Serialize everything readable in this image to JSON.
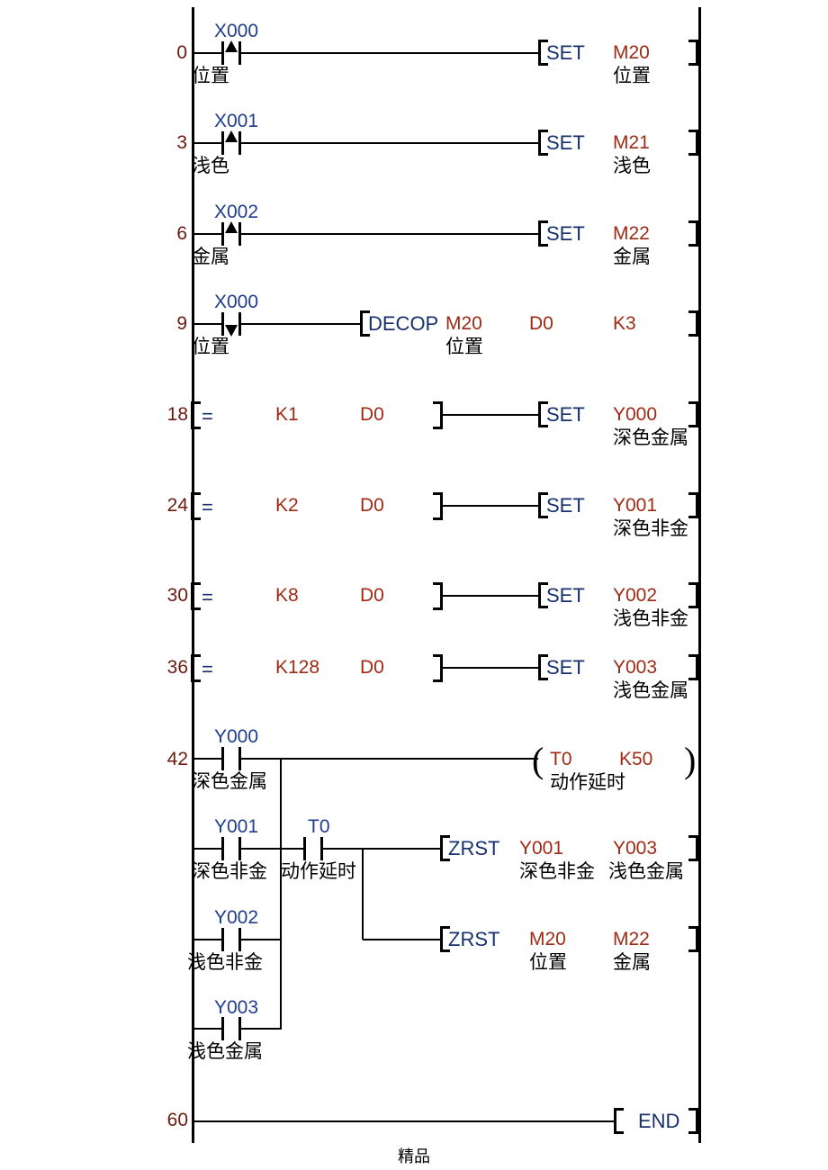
{
  "document": {
    "footer": "精品"
  },
  "colors": {
    "device_blue": "#1f3d8c",
    "device_red": "#9e2a14",
    "instruction": "#16306e",
    "comment": "#000000",
    "step_number": "#6a1b0e",
    "wire": "#000000"
  },
  "program": {
    "rungs": [
      {
        "step": "0",
        "contact": {
          "device": "X000",
          "comment": "位置",
          "type": "rising-edge"
        },
        "instruction": "SET",
        "operands": [
          {
            "device": "M20",
            "comment": "位置"
          }
        ]
      },
      {
        "step": "3",
        "contact": {
          "device": "X001",
          "comment": "浅色",
          "type": "rising-edge"
        },
        "instruction": "SET",
        "operands": [
          {
            "device": "M21",
            "comment": "浅色"
          }
        ]
      },
      {
        "step": "6",
        "contact": {
          "device": "X002",
          "comment": "金属",
          "type": "rising-edge"
        },
        "instruction": "SET",
        "operands": [
          {
            "device": "M22",
            "comment": "金属"
          }
        ]
      },
      {
        "step": "9",
        "contact": {
          "device": "X000",
          "comment": "位置",
          "type": "falling-edge"
        },
        "instruction": "DECOP",
        "operands": [
          {
            "device": "M20",
            "comment": "位置"
          },
          {
            "device": "D0",
            "comment": ""
          },
          {
            "device": "K3",
            "comment": ""
          }
        ]
      },
      {
        "step": "18",
        "compare": {
          "operator": "=",
          "left": "K1",
          "right": "D0"
        },
        "instruction": "SET",
        "operands": [
          {
            "device": "Y000",
            "comment": "深色金属"
          }
        ]
      },
      {
        "step": "24",
        "compare": {
          "operator": "=",
          "left": "K2",
          "right": "D0"
        },
        "instruction": "SET",
        "operands": [
          {
            "device": "Y001",
            "comment": "深色非金"
          }
        ]
      },
      {
        "step": "30",
        "compare": {
          "operator": "=",
          "left": "K8",
          "right": "D0"
        },
        "instruction": "SET",
        "operands": [
          {
            "device": "Y002",
            "comment": "浅色非金"
          }
        ]
      },
      {
        "step": "36",
        "compare": {
          "operator": "=",
          "left": "K128",
          "right": "D0"
        },
        "instruction": "SET",
        "operands": [
          {
            "device": "Y003",
            "comment": "浅色金属"
          }
        ]
      },
      {
        "step": "42",
        "branch_contacts": [
          {
            "device": "Y000",
            "comment": "深色金属",
            "type": "normally-open"
          },
          {
            "device": "Y001",
            "comment": "深色非金",
            "type": "normally-open"
          },
          {
            "device": "Y002",
            "comment": "浅色非金",
            "type": "normally-open"
          },
          {
            "device": "Y003",
            "comment": "浅色金属",
            "type": "normally-open"
          }
        ],
        "series_contact": {
          "device": "T0",
          "comment": "动作延时",
          "type": "normally-open"
        },
        "coil": {
          "device": "T0",
          "preset": "K50",
          "comment": "动作延时"
        },
        "outputs": [
          {
            "instruction": "ZRST",
            "operands": [
              {
                "device": "Y001",
                "comment": "深色非金"
              },
              {
                "device": "Y003",
                "comment": "浅色金属"
              }
            ]
          },
          {
            "instruction": "ZRST",
            "operands": [
              {
                "device": "M20",
                "comment": "位置"
              },
              {
                "device": "M22",
                "comment": "金属"
              }
            ]
          }
        ]
      },
      {
        "step": "60",
        "instruction": "END",
        "operands": []
      }
    ]
  }
}
